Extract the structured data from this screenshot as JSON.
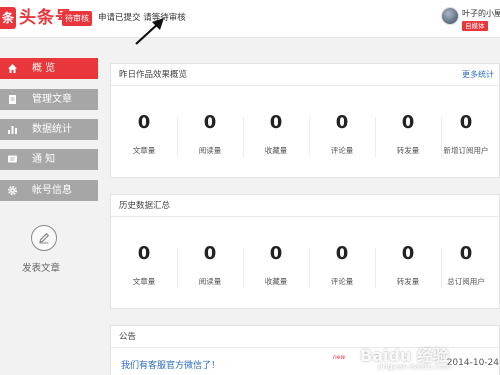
{
  "header": {
    "logo_mark": "条",
    "logo_text": "头条号",
    "status_badge": "待审核",
    "notice": "申请已提交 请等待审核",
    "username": "叶子的小屋",
    "user_badge": "自媒体"
  },
  "sidebar": {
    "items": [
      {
        "label": "概    览",
        "icon": "home-icon",
        "active": true
      },
      {
        "label": "管理文章",
        "icon": "document-icon",
        "active": false
      },
      {
        "label": "数据统计",
        "icon": "bar-chart-icon",
        "active": false
      },
      {
        "label": "通    知",
        "icon": "message-icon",
        "active": false
      },
      {
        "label": "帐号信息",
        "icon": "gear-icon",
        "active": false
      }
    ],
    "publish_label": "发表文章"
  },
  "yesterday": {
    "title": "昨日作品效果概览",
    "more": "更多统计",
    "stats": [
      {
        "value": "0",
        "label": "文章量"
      },
      {
        "value": "0",
        "label": "阅读量"
      },
      {
        "value": "0",
        "label": "收藏量"
      },
      {
        "value": "0",
        "label": "评论量"
      },
      {
        "value": "0",
        "label": "转发量"
      },
      {
        "value": "0",
        "label": "新增订阅用户"
      }
    ]
  },
  "history": {
    "title": "历史数据汇总",
    "stats": [
      {
        "value": "0",
        "label": "文章量"
      },
      {
        "value": "0",
        "label": "阅读量"
      },
      {
        "value": "0",
        "label": "收藏量"
      },
      {
        "value": "0",
        "label": "评论量"
      },
      {
        "value": "0",
        "label": "转发量"
      },
      {
        "value": "0",
        "label": "总订阅用户"
      }
    ]
  },
  "announcement": {
    "title": "公告",
    "item_text": "我们有客服官方微信了！",
    "new_tag": "new",
    "date": "2014-10-24"
  },
  "watermark": {
    "text": "Baidu 经验",
    "sub": "jingyan.baidu.com"
  }
}
